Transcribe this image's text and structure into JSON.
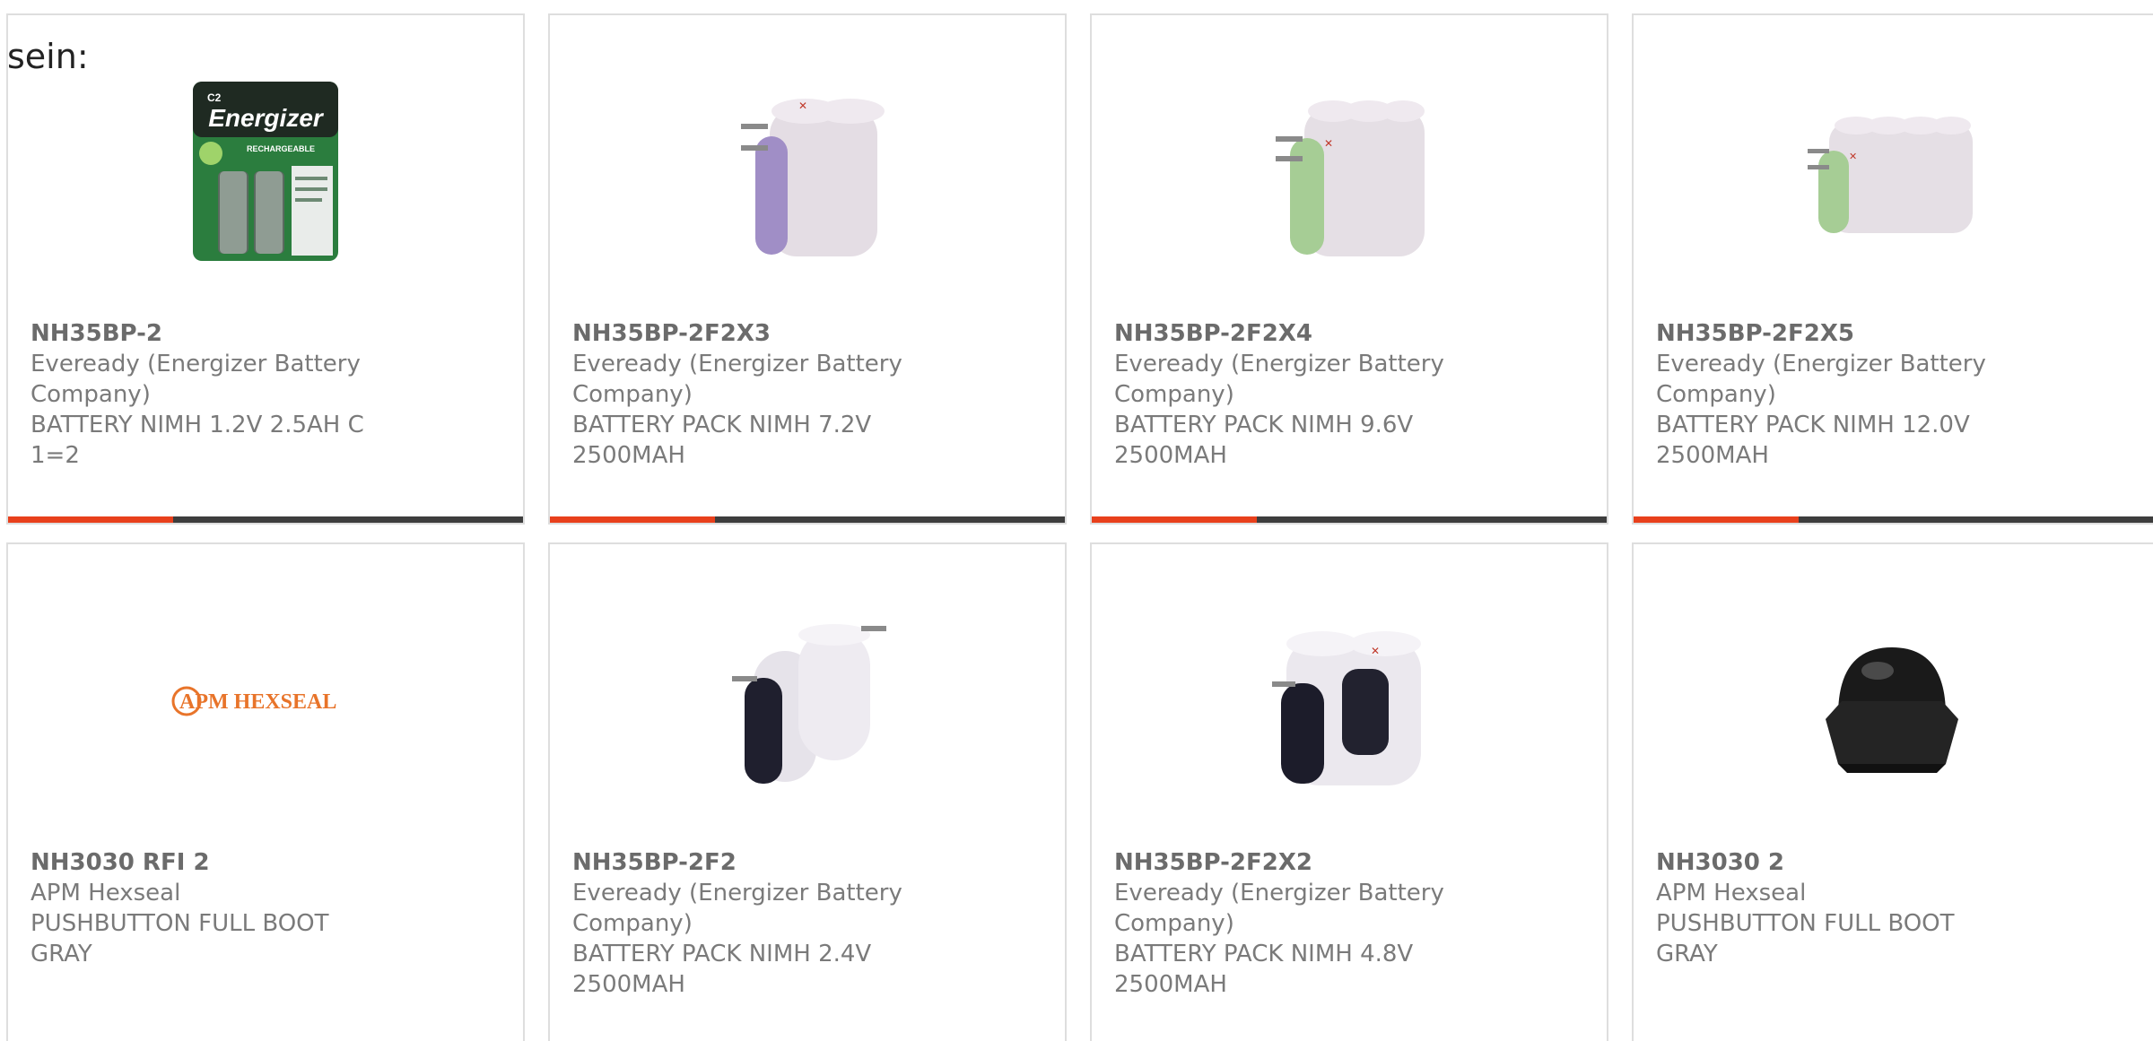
{
  "intro_text": "sein:",
  "colors": {
    "accent": "#e8401c",
    "bar": "#3d3d3d",
    "card_border": "#dedede",
    "text": "#7a7a7a"
  },
  "products": [
    {
      "part_number": "NH35BP-2",
      "manufacturer": "Eveready (Energizer Battery Company)",
      "description": "BATTERY NIMH 1.2V 2.5AH C 1=2",
      "image": "energizer-c2-blister-pack",
      "image_texts": [
        "Energizer",
        "C2",
        "RECHARGEABLE"
      ]
    },
    {
      "part_number": "NH35BP-2F2X3",
      "manufacturer": "Eveready (Energizer Battery Company)",
      "description": "BATTERY PACK NIMH 7.2V 2500MAH",
      "image": "battery-pack-3-cells-purple"
    },
    {
      "part_number": "NH35BP-2F2X4",
      "manufacturer": "Eveready (Energizer Battery Company)",
      "description": "BATTERY PACK NIMH 9.6V 2500MAH",
      "image": "battery-pack-4-cells-green"
    },
    {
      "part_number": "NH35BP-2F2X5",
      "manufacturer": "Eveready (Energizer Battery Company)",
      "description": "BATTERY PACK NIMH 12.0V 2500MAH",
      "image": "battery-pack-5-cells-green"
    },
    {
      "part_number": "NH3030 RFI 2",
      "manufacturer": "APM Hexseal",
      "description": "PUSHBUTTON FULL BOOT GRAY",
      "image": "apm-hexseal-logo",
      "image_texts": [
        "APM HEXSEAL"
      ]
    },
    {
      "part_number": "NH35BP-2F2",
      "manufacturer": "Eveready (Energizer Battery Company)",
      "description": "BATTERY PACK NIMH 2.4V 2500MAH",
      "image": "battery-pack-2-cells-dark"
    },
    {
      "part_number": "NH35BP-2F2X2",
      "manufacturer": "Eveready (Energizer Battery Company)",
      "description": "BATTERY PACK NIMH 4.8V 2500MAH",
      "image": "battery-pack-4-cells-dark"
    },
    {
      "part_number": "NH3030 2",
      "manufacturer": "APM Hexseal",
      "description": "PUSHBUTTON FULL BOOT GRAY",
      "image": "black-pushbutton-boot"
    }
  ]
}
